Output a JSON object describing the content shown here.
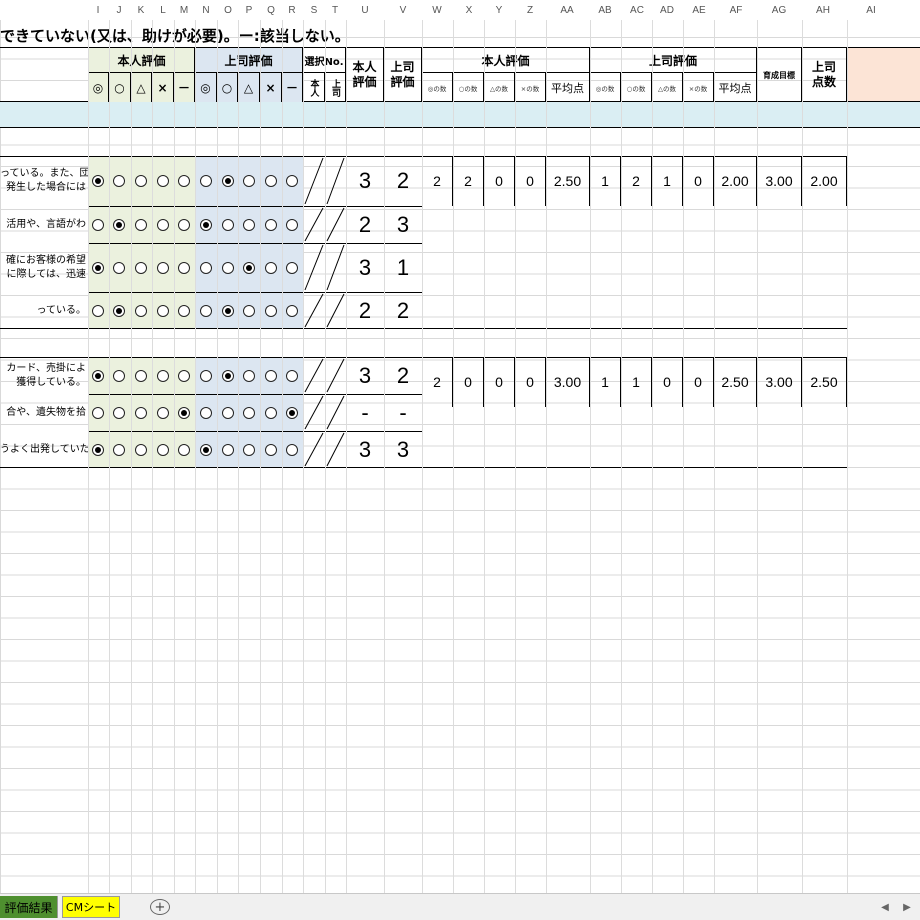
{
  "columns": [
    "I",
    "J",
    "K",
    "L",
    "M",
    "N",
    "O",
    "P",
    "Q",
    "R",
    "S",
    "T",
    "U",
    "V",
    "W",
    "X",
    "Y",
    "Z",
    "AA",
    "AB",
    "AC",
    "AD",
    "AE",
    "AF",
    "AG",
    "AH",
    "AI"
  ],
  "title_legend": "できていない(又は、助けが必要)。ー:該当しない。",
  "headers": {
    "self_eval": "本人評価",
    "boss_eval": "上司評価",
    "symbols": [
      "◎",
      "○",
      "△",
      "×",
      "－"
    ],
    "select_no": "選択No.",
    "select_self": "本人",
    "select_boss": "上司",
    "col_self_eval": "本人評価",
    "col_boss_eval": "上司評価",
    "sum_self": "本人評価",
    "sum_boss": "上司評価",
    "count_labels": [
      "◎の数",
      "○の数",
      "△の数",
      "×の数"
    ],
    "avg": "平均点",
    "growth_target": "育成目標",
    "boss_points": "上司点数"
  },
  "rows": [
    {
      "desc": [
        "っている。また、団",
        "発生した場合には"
      ],
      "self_pick": 0,
      "boss_pick": 1,
      "self": "3",
      "boss": "2"
    },
    {
      "desc": [
        "活用や、言語がわ"
      ],
      "self_pick": 1,
      "boss_pick": 0,
      "self": "2",
      "boss": "3"
    },
    {
      "desc": [
        "確にお客様の希望",
        "に際しては、迅速"
      ],
      "self_pick": 0,
      "boss_pick": 2,
      "self": "3",
      "boss": "1"
    },
    {
      "desc": [
        "っている。"
      ],
      "self_pick": 1,
      "boss_pick": 1,
      "self": "2",
      "boss": "2"
    },
    {
      "desc": [
        "カード、売掛によ",
        "獲得している。"
      ],
      "self_pick": 0,
      "boss_pick": 1,
      "self": "3",
      "boss": "2"
    },
    {
      "desc": [
        "合や、遺失物を拾"
      ],
      "self_pick": 4,
      "boss_pick": 4,
      "self": "-",
      "boss": "-"
    },
    {
      "desc": [
        "うよく出発していた"
      ],
      "self_pick": 0,
      "boss_pick": 0,
      "self": "3",
      "boss": "3"
    }
  ],
  "groups": [
    {
      "self_counts": [
        "2",
        "2",
        "0",
        "0"
      ],
      "self_avg": "2.50",
      "boss_counts": [
        "1",
        "2",
        "1",
        "0"
      ],
      "boss_avg": "2.00",
      "target": "3.00",
      "boss_points": "2.00"
    },
    {
      "self_counts": [
        "2",
        "0",
        "0",
        "0"
      ],
      "self_avg": "3.00",
      "boss_counts": [
        "1",
        "1",
        "0",
        "0"
      ],
      "boss_avg": "2.50",
      "target": "3.00",
      "boss_points": "2.50"
    }
  ],
  "tabs": {
    "eval_result": "評価結果",
    "cm_sheet": "CMシート",
    "add_sheet": "+"
  },
  "colors": {
    "self_fill": "#ebf1de",
    "boss_fill": "#dce6f1",
    "section_band": "#daeef3",
    "header_peach": "#fce4d6",
    "tab_green": "#4e8f2f",
    "tab_yellow": "#ffff00"
  }
}
